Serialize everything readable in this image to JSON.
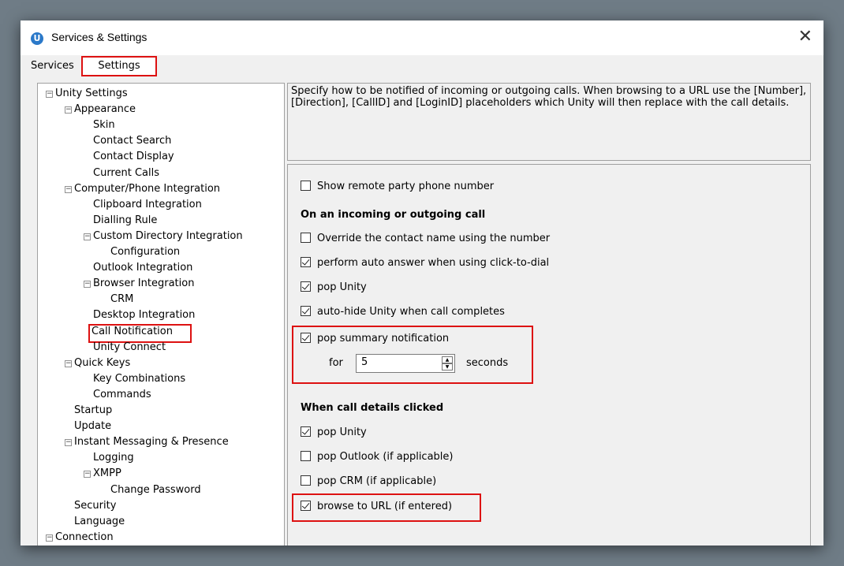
{
  "window": {
    "title": "Services & Settings",
    "logo_letter": "U",
    "close_glyph": "✕"
  },
  "tabs": [
    {
      "label": "Services",
      "active": false
    },
    {
      "label": "Settings",
      "active": true
    }
  ],
  "tree": [
    {
      "label": "Unity Settings",
      "level": 0,
      "expander": "minus"
    },
    {
      "label": "Appearance",
      "level": 1,
      "expander": "minus"
    },
    {
      "label": "Skin",
      "level": 2
    },
    {
      "label": "Contact Search",
      "level": 2
    },
    {
      "label": "Contact Display",
      "level": 2
    },
    {
      "label": "Current Calls",
      "level": 2
    },
    {
      "label": "Computer/Phone Integration",
      "level": 1,
      "expander": "minus"
    },
    {
      "label": "Clipboard Integration",
      "level": 2
    },
    {
      "label": "Dialling Rule",
      "level": 2
    },
    {
      "label": "Custom Directory Integration",
      "level": 2,
      "expander": "minus"
    },
    {
      "label": "Configuration",
      "level": 3
    },
    {
      "label": "Outlook Integration",
      "level": 2
    },
    {
      "label": "Browser Integration",
      "level": 2,
      "expander": "minus"
    },
    {
      "label": "CRM",
      "level": 3
    },
    {
      "label": "Desktop Integration",
      "level": 2
    },
    {
      "label": "Call Notification",
      "level": 2,
      "selected": true
    },
    {
      "label": "Unity Connect",
      "level": 2
    },
    {
      "label": "Quick Keys",
      "level": 1,
      "expander": "minus"
    },
    {
      "label": "Key Combinations",
      "level": 2
    },
    {
      "label": "Commands",
      "level": 2
    },
    {
      "label": "Startup",
      "level": 1
    },
    {
      "label": "Update",
      "level": 1
    },
    {
      "label": "Instant Messaging & Presence",
      "level": 1,
      "expander": "minus"
    },
    {
      "label": "Logging",
      "level": 2
    },
    {
      "label": "XMPP",
      "level": 2,
      "expander": "minus"
    },
    {
      "label": "Change Password",
      "level": 3
    },
    {
      "label": "Security",
      "level": 1
    },
    {
      "label": "Language",
      "level": 1
    },
    {
      "label": "Connection",
      "level": 0,
      "expander": "minus"
    }
  ],
  "description": "Specify how to be notified of incoming or outgoing calls.  When browsing to a URL use the [Number], [Direction], [CallID] and [LoginID] placeholders which Unity will then replace with the call details.",
  "settings": {
    "show_remote_party": {
      "label": "Show remote party phone number",
      "checked": false
    },
    "section_incoming": "On an incoming or outgoing call",
    "override_contact": {
      "label": "Override the contact name using the number",
      "checked": false
    },
    "auto_answer": {
      "label": "perform auto answer when using click-to-dial",
      "checked": true
    },
    "pop_unity": {
      "label": "pop Unity",
      "checked": true
    },
    "auto_hide": {
      "label": "auto-hide Unity when call completes",
      "checked": true
    },
    "pop_summary": {
      "label": "pop summary notification",
      "checked": true
    },
    "duration_for_label": "for",
    "duration_value": "5",
    "duration_unit_label": "seconds",
    "section_details": "When call details clicked",
    "details_pop_unity": {
      "label": "pop Unity",
      "checked": true
    },
    "details_pop_outlook": {
      "label": "pop Outlook (if applicable)",
      "checked": false
    },
    "details_pop_crm": {
      "label": "pop CRM (if applicable)",
      "checked": false
    },
    "details_browse_url": {
      "label": "browse to URL (if entered)",
      "checked": true
    }
  },
  "colors": {
    "highlight_border": "#dd1111",
    "backdrop": "#6f7c86",
    "logo": "#2b79c9"
  }
}
